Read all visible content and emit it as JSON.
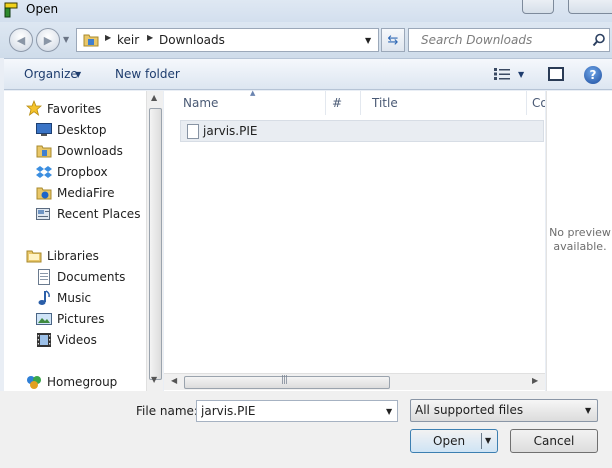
{
  "window": {
    "title": "Open"
  },
  "address": {
    "breadcrumbs": [
      {
        "label": "keir"
      },
      {
        "label": "Downloads"
      }
    ],
    "search_placeholder": "Search Downloads"
  },
  "toolbar": {
    "organize_label": "Organize",
    "new_folder_label": "New folder"
  },
  "nav": {
    "favorites": {
      "label": "Favorites",
      "items": [
        {
          "label": "Desktop",
          "icon": "desktop-icon"
        },
        {
          "label": "Downloads",
          "icon": "downloads-folder-icon"
        },
        {
          "label": "Dropbox",
          "icon": "dropbox-icon"
        },
        {
          "label": "MediaFire",
          "icon": "mediafire-icon"
        },
        {
          "label": "Recent Places",
          "icon": "recent-places-icon"
        }
      ]
    },
    "libraries": {
      "label": "Libraries",
      "items": [
        {
          "label": "Documents",
          "icon": "documents-icon"
        },
        {
          "label": "Music",
          "icon": "music-icon"
        },
        {
          "label": "Pictures",
          "icon": "pictures-icon"
        },
        {
          "label": "Videos",
          "icon": "videos-icon"
        }
      ]
    },
    "homegroup": {
      "label": "Homegroup"
    }
  },
  "file_list": {
    "columns": [
      {
        "label": "Name"
      },
      {
        "label": "#"
      },
      {
        "label": "Title"
      },
      {
        "label": "Co"
      }
    ],
    "files": [
      {
        "name": "jarvis.PIE",
        "icon": "file-icon"
      }
    ]
  },
  "preview": {
    "text_line1": "No preview",
    "text_line2": "available."
  },
  "bottom": {
    "file_name_label": "File name:",
    "file_name_value": "jarvis.PIE",
    "filter_value": "All supported files",
    "open_label": "Open",
    "cancel_label": "Cancel"
  },
  "colors": {
    "accent": "#1e3d6e",
    "window_frame": "#dde7f2",
    "selection": "#e9edf2"
  }
}
